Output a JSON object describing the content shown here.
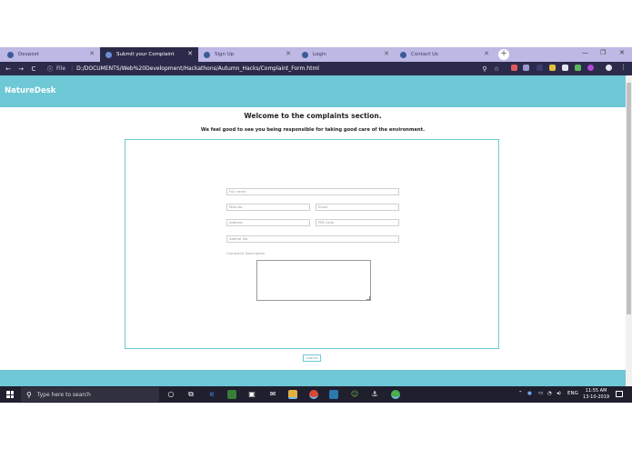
{
  "browser": {
    "tabs": [
      {
        "title": "Devpost",
        "active": false
      },
      {
        "title": "Submit your Complaint",
        "active": true
      },
      {
        "title": "Sign Up",
        "active": false
      },
      {
        "title": "Login",
        "active": false
      },
      {
        "title": "Contact Us",
        "active": false
      }
    ],
    "address": {
      "scheme_label": "File",
      "url": "D:/DOCUMENTS/Web%20Development/Hackathons/Autumn_Hacks/Complaint_Form.html"
    }
  },
  "page": {
    "brand": "NatureDesk",
    "heading": "Welcome to the complaints section.",
    "subheading": "We feel good to see you being responsible for taking good care of the environment.",
    "form": {
      "full_name_placeholder": "Full name",
      "mob_placeholder": "Mob No.",
      "email_placeholder": "Email",
      "address_placeholder": "Address",
      "pincode_placeholder": "PIN Code",
      "aadhar_placeholder": "Aadhar No.",
      "description_label": "Complaint Description",
      "submit_label": "submit"
    },
    "colors": {
      "accent": "#6ec8d6"
    }
  },
  "taskbar": {
    "search_placeholder": "Type here to search",
    "lang": "ENG",
    "time": "11:55 AM",
    "date": "13-10-2019"
  }
}
